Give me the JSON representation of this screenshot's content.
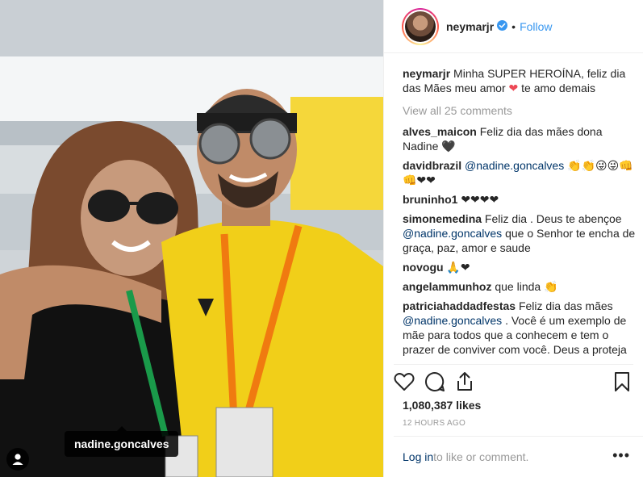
{
  "photo": {
    "tag_label": "nadine.goncalves",
    "user_tag_icon": "user-icon"
  },
  "header": {
    "username": "neymarjr",
    "follow_label": "Follow",
    "separator": "•",
    "verified_icon": "verified-badge-icon"
  },
  "caption": {
    "username": "neymarjr",
    "text_before_heart": " Minha SUPER HEROÍNA, feliz dia das Mães meu amor ",
    "text_after_heart": " te amo demais"
  },
  "view_all_label": "View all 25 comments",
  "comments": [
    {
      "user": "alves_maicon",
      "text": " Feliz dia das mães dona Nadine 🖤"
    },
    {
      "user": "davidbrazil",
      "mention": "@nadine.goncalves",
      "text": " 👏👏😜😜👊👊❤❤"
    },
    {
      "user": "bruninho1",
      "text": " ❤❤❤❤"
    },
    {
      "user": "simonemedina",
      "text": " Feliz dia . Deus te abençoe ",
      "mention": "@nadine.goncalves",
      "text2": " que o Senhor te encha de graça, paz, amor e saude"
    },
    {
      "user": "novogu",
      "text": " 🙏❤"
    },
    {
      "user": "angelammunhoz",
      "text": " que linda 👏"
    },
    {
      "user": "patriciahaddadfestas",
      "text": " Feliz dia das mães ",
      "mention": "@nadine.goncalves",
      "text2": " . Você é um exemplo de mãe para todos que a conhecem e tem o prazer de conviver com você. Deus a proteja"
    }
  ],
  "actions": {
    "like_icon": "heart-icon",
    "comment_icon": "comment-icon",
    "share_icon": "share-icon",
    "save_icon": "bookmark-icon"
  },
  "likes": "1,080,387 likes",
  "timestamp": "12 HOURS AGO",
  "add_comment": {
    "login_label": "Log in",
    "rest": " to like or comment.",
    "more_label": "•••"
  },
  "colors": {
    "link": "#003569",
    "follow": "#3897f0",
    "muted": "#999999",
    "heart": "#ed4956"
  }
}
